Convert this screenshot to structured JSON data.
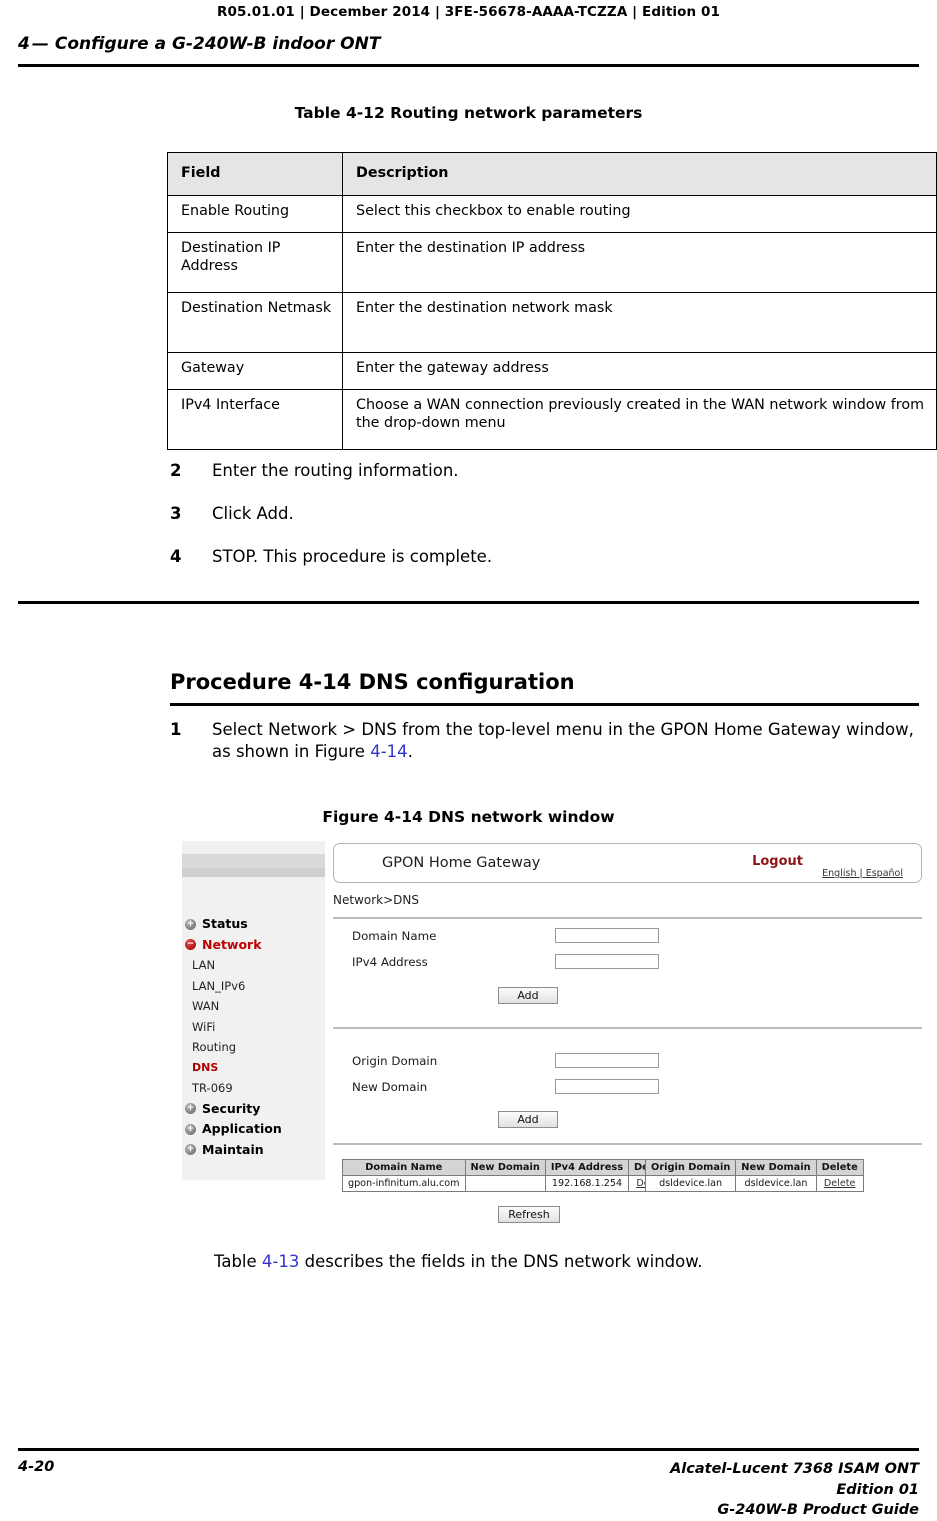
{
  "page": {
    "header_line": "R05.01.01 | December 2014 | 3FE-56678-AAAA-TCZZA | Edition 01",
    "chapter_number": "4",
    "chapter_dash": "—",
    "chapter_title": "Configure a G-240W-B indoor ONT",
    "footer_page": "4-20",
    "footer_line1": "Alcatel-Lucent 7368 ISAM ONT",
    "footer_line2": "Edition 01",
    "footer_line3": "G-240W-B Product Guide",
    "xref_color": "#3333cc"
  },
  "table_412": {
    "caption": "Table 4-12 Routing network parameters",
    "headers": [
      "Field",
      "Description"
    ],
    "rows": [
      {
        "field": "Enable Routing",
        "description": "Select this checkbox to enable routing"
      },
      {
        "field": "Destination IP Address",
        "description": "Enter the destination IP address"
      },
      {
        "field": "Destination Netmask",
        "description": "Enter the destination network mask"
      },
      {
        "field": "Gateway",
        "description": "Enter the gateway address"
      },
      {
        "field": "IPv4 Interface",
        "description": "Choose a WAN connection previously created in the WAN network window from the drop-down menu"
      }
    ]
  },
  "steps_routing": [
    {
      "num": "2",
      "text": "Enter the routing information."
    },
    {
      "num": "3",
      "text": "Click Add."
    },
    {
      "num": "4",
      "text": "STOP. This procedure is complete."
    }
  ],
  "procedure_414": {
    "title": "Procedure 4-14  DNS configuration",
    "step1_num": "1",
    "step1_text_a": "Select Network > DNS from the top-level menu in the GPON Home Gateway window, as shown in Figure ",
    "step1_xref": "4-14",
    "step1_text_b": ".",
    "figure_caption": "Figure 4-14  DNS network window"
  },
  "after_figure": {
    "text_a": "Table ",
    "xref": "4-13",
    "text_b": " describes the fields in the DNS network window."
  },
  "router_ui": {
    "brand": "GPON Home Gateway",
    "logout": "Logout",
    "languages": "English | Español",
    "lang_en": "English",
    "lang_sep": " | ",
    "lang_es": "Español",
    "breadcrumb": "Network>DNS",
    "sidebar": [
      {
        "label": "Status",
        "type": "top",
        "icon": "plus-circle-icon",
        "state": "collapsed",
        "color": "#1a1a1a"
      },
      {
        "label": "Network",
        "type": "top",
        "icon": "minus-circle-icon",
        "state": "expanded",
        "color": "#c00000"
      },
      {
        "label": "LAN",
        "type": "sub",
        "active": false
      },
      {
        "label": "LAN_IPv6",
        "type": "sub",
        "active": false
      },
      {
        "label": "WAN",
        "type": "sub",
        "active": false
      },
      {
        "label": "WiFi",
        "type": "sub",
        "active": false
      },
      {
        "label": "Routing",
        "type": "sub",
        "active": false
      },
      {
        "label": "DNS",
        "type": "sub",
        "active": true
      },
      {
        "label": "TR-069",
        "type": "sub",
        "active": false
      },
      {
        "label": "Security",
        "type": "top",
        "icon": "plus-circle-icon",
        "state": "collapsed",
        "color": "#1a1a1a"
      },
      {
        "label": "Application",
        "type": "top",
        "icon": "plus-circle-icon",
        "state": "collapsed",
        "color": "#1a1a1a"
      },
      {
        "label": "Maintain",
        "type": "top",
        "icon": "plus-circle-icon",
        "state": "collapsed",
        "color": "#1a1a1a"
      }
    ],
    "form_dns": {
      "domain_name_label": "Domain Name",
      "domain_name_value": "",
      "ipv4_address_label": "IPv4 Address",
      "ipv4_address_value": "",
      "add_label": "Add"
    },
    "form_alias": {
      "origin_domain_label": "Origin Domain",
      "origin_domain_value": "",
      "new_domain_label": "New Domain",
      "new_domain_value": "",
      "add_label": "Add"
    },
    "grid_left": {
      "headers": [
        "Domain Name",
        "New Domain",
        "IPv4 Address",
        "Delete"
      ],
      "rows": [
        {
          "domain_name": "gpon-infinitum.alu.com",
          "new_domain": "",
          "ipv4_address": "192.168.1.254",
          "delete": "Delete"
        }
      ]
    },
    "grid_right": {
      "headers": [
        "Origin Domain",
        "New Domain",
        "Delete"
      ],
      "rows": [
        {
          "origin_domain": "dsldevice.lan",
          "new_domain": "dsldevice.lan",
          "delete": "Delete"
        }
      ]
    },
    "refresh_label": "Refresh"
  }
}
